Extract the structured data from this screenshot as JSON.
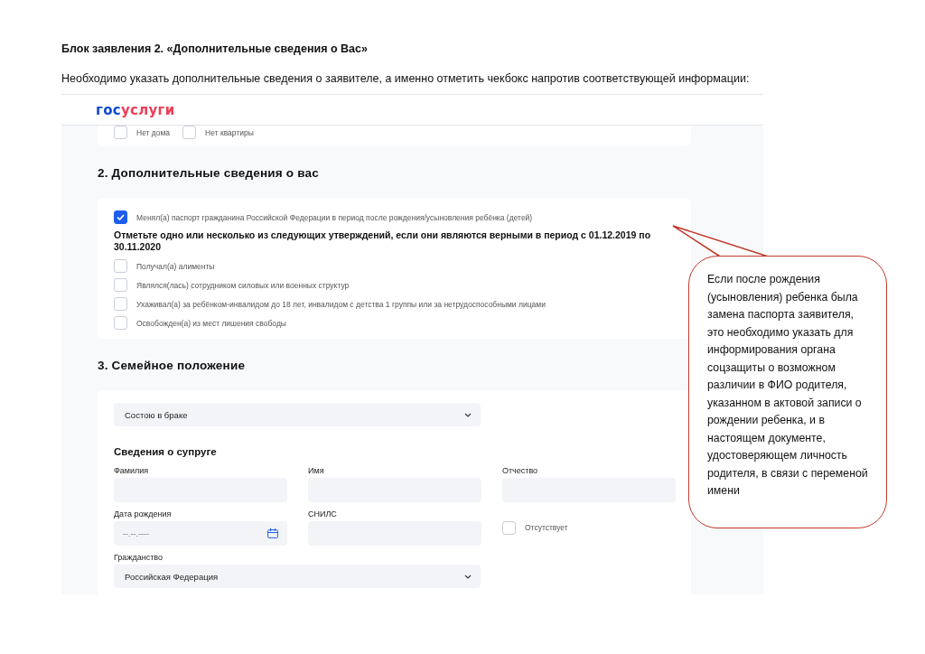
{
  "document": {
    "heading": "Блок заявления 2. «Дополнительные сведения о Вас»",
    "intro": "Необходимо указать дополнительные сведения о заявителе, а именно отметить чекбокс напротив соответствующей информации:"
  },
  "form": {
    "logo": {
      "part_1": "гос",
      "part_2": "услуги"
    },
    "housing_options": [
      {
        "label": "Нет дома",
        "checked": false
      },
      {
        "label": "Нет квартиры",
        "checked": false
      }
    ],
    "section_2": {
      "title": "2. Дополнительные сведения о вас",
      "passport_change": {
        "label": "Менял(а) паспорт гражданина Российской Федерации в период после рождения/усыновления ребёнка (детей)",
        "checked": true
      },
      "prompt": "Отметьте одно или несколько из следующих утверждений, если они являются верными в период с 01.12.2019 по 30.11.2020",
      "statements": [
        {
          "label": "Получал(а) алименты",
          "checked": false
        },
        {
          "label": "Являлся(лась) сотрудником силовых или военных структур",
          "checked": false
        },
        {
          "label": "Ухаживал(а) за ребёнком-инвалидом до 18 лет, инвалидом с детства 1 группы или за нетрудоспособными лицами",
          "checked": false
        },
        {
          "label": "Освобожден(а) из мест лишения свободы",
          "checked": false
        }
      ]
    },
    "section_3": {
      "title": "3. Семейное положение",
      "marital_status": "Состою в браке",
      "spouse": {
        "title": "Сведения о супруге",
        "fields": [
          {
            "kind": "text",
            "label": "Фамилия"
          },
          {
            "kind": "text",
            "label": "Имя"
          },
          {
            "kind": "text",
            "label": "Отчество"
          },
          {
            "kind": "date",
            "label": "Дата рождения",
            "placeholder": "--.--.----"
          },
          {
            "kind": "text",
            "label": "СНИЛС"
          },
          {
            "kind": "checkbox",
            "label": "Отсутствует",
            "checked": false
          },
          {
            "kind": "select",
            "label": "Гражданство",
            "value": "Российская Федерация"
          }
        ]
      }
    }
  },
  "callout": {
    "text": "Если после рождения (усыновления) ребенка была замена паспорта заявителя, это необходимо указать для информирования органа соцзащиты о возможном различии в ФИО родителя, указанном в актовой записи о рождении ребенка, и в настоящем документе, удостоверяющем личность родителя, в связи с переменой имени"
  }
}
